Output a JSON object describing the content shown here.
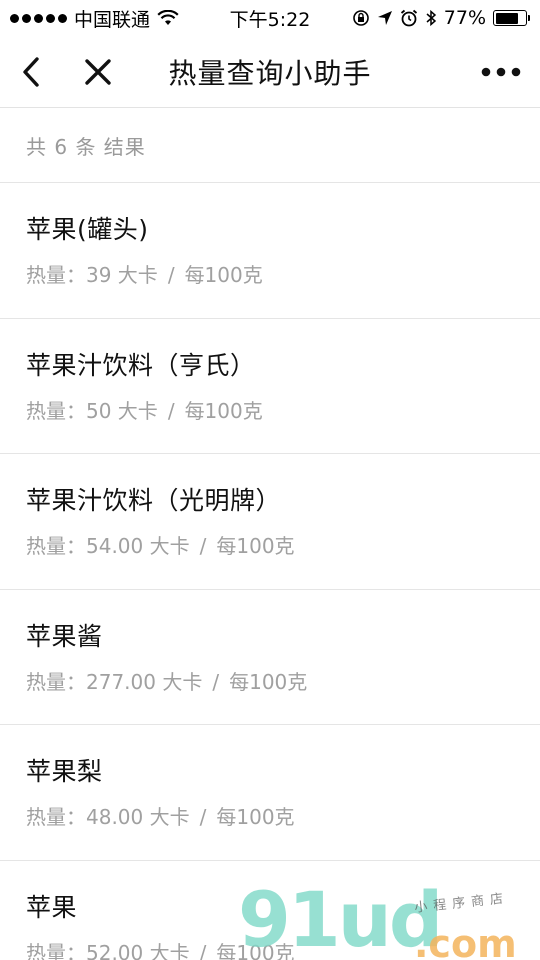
{
  "status_bar": {
    "carrier": "中国联通",
    "time": "下午5:22",
    "battery": "77%",
    "battery_level": 0.77,
    "icons": [
      "signal-dots",
      "wifi-icon",
      "rotation-lock-icon",
      "location-arrow-icon",
      "alarm-icon",
      "bluetooth-icon",
      "battery-icon"
    ]
  },
  "nav": {
    "title": "热量查询小助手",
    "icons": [
      "back-chevron-icon",
      "close-icon",
      "more-dots-icon"
    ]
  },
  "result_count": "共 6 条 结果",
  "items": [
    {
      "name": "苹果(罐头)",
      "cal_label": "热量：",
      "cal": "39 大卡",
      "unit": "每100克"
    },
    {
      "name": "苹果汁饮料（亨氏）",
      "cal_label": "热量：",
      "cal": "50 大卡",
      "unit": "每100克"
    },
    {
      "name": "苹果汁饮料（光明牌）",
      "cal_label": "热量：",
      "cal": "54.00 大卡",
      "unit": "每100克"
    },
    {
      "name": "苹果酱",
      "cal_label": "热量：",
      "cal": "277.00 大卡",
      "unit": "每100克"
    },
    {
      "name": "苹果梨",
      "cal_label": "热量：",
      "cal": "48.00 大卡",
      "unit": "每100克"
    },
    {
      "name": "苹果",
      "cal_label": "热量：",
      "cal": "52.00 大卡",
      "unit": "每100克"
    }
  ],
  "separator": "/",
  "watermark": {
    "main": "91ud",
    "sub": ".com",
    "tag": "小程序商店"
  },
  "colors": {
    "text_primary": "#111111",
    "text_secondary": "#a0a0a0",
    "divider": "#e5e5e5",
    "watermark_green": "#7ed9c8",
    "watermark_orange": "#f4b45c"
  }
}
